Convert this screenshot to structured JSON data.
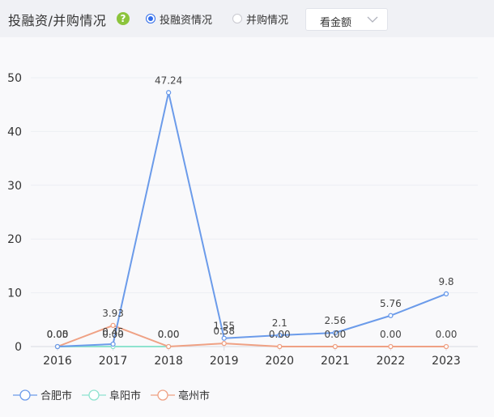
{
  "header": {
    "title": "投融资/并购情况",
    "help_icon": "question-icon",
    "radios": [
      {
        "label": "投融资情况",
        "selected": true
      },
      {
        "label": "并购情况",
        "selected": false
      }
    ],
    "select": {
      "value": "看金额",
      "icon": "chevron-down-icon"
    }
  },
  "colors": {
    "hefei": "#6b9bea",
    "fuyang": "#8fe3cf",
    "bozhou": "#efa184",
    "accent": "#2f6bea"
  },
  "chart_data": {
    "type": "line",
    "x": [
      "2016",
      "2017",
      "2018",
      "2019",
      "2020",
      "2021",
      "2022",
      "2023"
    ],
    "ylim": [
      0,
      50
    ],
    "yticks": [
      "0",
      "10",
      "20",
      "30",
      "40",
      "50"
    ],
    "legend_position": "bottom-left",
    "series": [
      {
        "name": "合肥市",
        "values": [
          0,
          0.45,
          47.24,
          1.55,
          2.1,
          2.56,
          5.76,
          9.8
        ],
        "labels": [
          "0.05",
          "0.45",
          "47.24",
          "1.55",
          "2.1",
          "2.56",
          "5.76",
          "9.8"
        ]
      },
      {
        "name": "阜阳市",
        "values": [
          0,
          0,
          0,
          null,
          null,
          null,
          null,
          null
        ],
        "labels": [
          "0.00",
          "0.00",
          "0.00",
          "",
          "",
          "",
          "",
          ""
        ]
      },
      {
        "name": "亳州市",
        "values": [
          0,
          3.93,
          0,
          0.58,
          0,
          0,
          0,
          0
        ],
        "labels": [
          "0.00",
          "3.93",
          "0.00",
          "0.58",
          "0.00",
          "0.00",
          "0.00",
          "0.00"
        ]
      }
    ]
  }
}
